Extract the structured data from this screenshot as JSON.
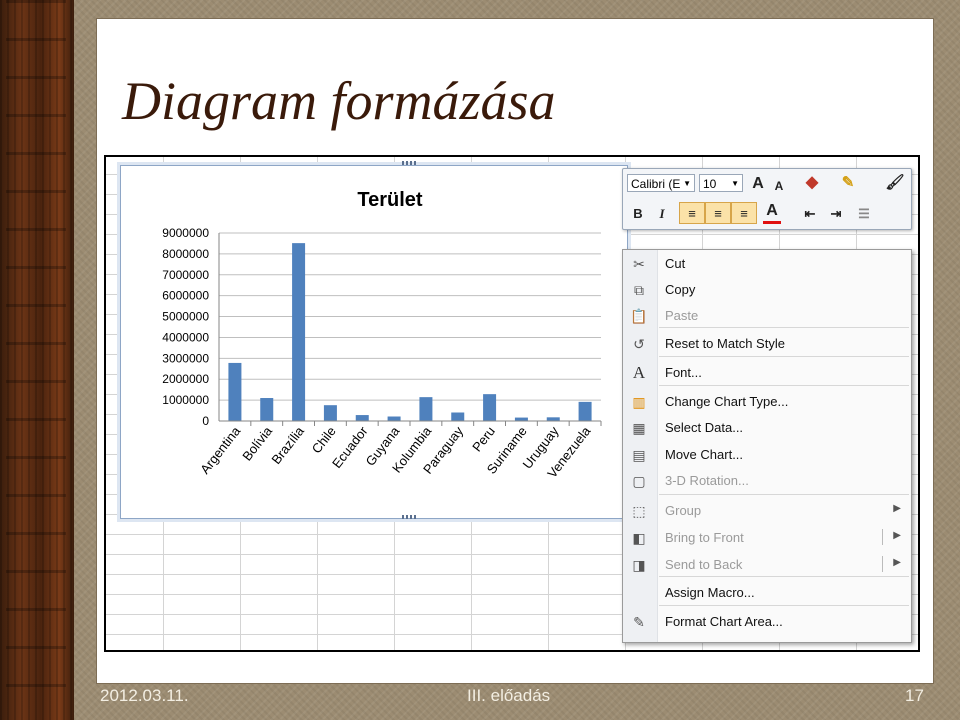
{
  "slide": {
    "title": "Diagram formázása",
    "side_text": [
      "",
      "",
      ""
    ]
  },
  "chart_data": {
    "type": "bar",
    "title": "Terület",
    "categories": [
      "Argentina",
      "Bolívia",
      "Brazília",
      "Chile",
      "Ecuador",
      "Guyana",
      "Kolumbia",
      "Paraguay",
      "Peru",
      "Suriname",
      "Uruguay",
      "Venezuela"
    ],
    "values": [
      2780000,
      1100000,
      8515000,
      757000,
      284000,
      215000,
      1142000,
      407000,
      1285000,
      164000,
      176000,
      916000
    ],
    "ylim": [
      0,
      9000000
    ],
    "yticks": [
      "0",
      "1000000",
      "2000000",
      "3000000",
      "4000000",
      "5000000",
      "6000000",
      "7000000",
      "8000000",
      "9000000"
    ],
    "bar_color": "#4f81bd",
    "grid": true,
    "legend": "none"
  },
  "mini_toolbar": {
    "font_name": "Calibri (E",
    "font_size": "10",
    "grow_font": "A",
    "shrink_font": "A",
    "bold": "B",
    "italic": "I",
    "font_color": "A"
  },
  "context_menu": {
    "items": [
      {
        "label": "Cut",
        "icon": "scissors-icon",
        "enabled": true
      },
      {
        "label": "Copy",
        "icon": "copy-icon",
        "enabled": true
      },
      {
        "label": "Paste",
        "icon": "paste-icon",
        "enabled": false
      },
      {
        "label": "Reset to Match Style",
        "icon": "reset-style-icon",
        "enabled": true
      },
      {
        "label": "Font...",
        "icon": "font-icon",
        "enabled": true
      },
      {
        "label": "Change Chart Type...",
        "icon": "chart-type-icon",
        "enabled": true
      },
      {
        "label": "Select Data...",
        "icon": "select-data-icon",
        "enabled": true
      },
      {
        "label": "Move Chart...",
        "icon": "move-chart-icon",
        "enabled": true
      },
      {
        "label": "3-D Rotation...",
        "icon": "rotation-icon",
        "enabled": false
      },
      {
        "label": "Group",
        "icon": "group-icon",
        "enabled": false
      },
      {
        "label": "Bring to Front",
        "icon": "bring-front-icon",
        "enabled": false
      },
      {
        "label": "Send to Back",
        "icon": "send-back-icon",
        "enabled": false
      },
      {
        "label": "Assign Macro...",
        "icon": "",
        "enabled": true
      },
      {
        "label": "Format Chart Area...",
        "icon": "format-area-icon",
        "enabled": true
      }
    ]
  },
  "footer": {
    "date": "2012.03.11.",
    "center": "III. előadás",
    "page": "17"
  }
}
